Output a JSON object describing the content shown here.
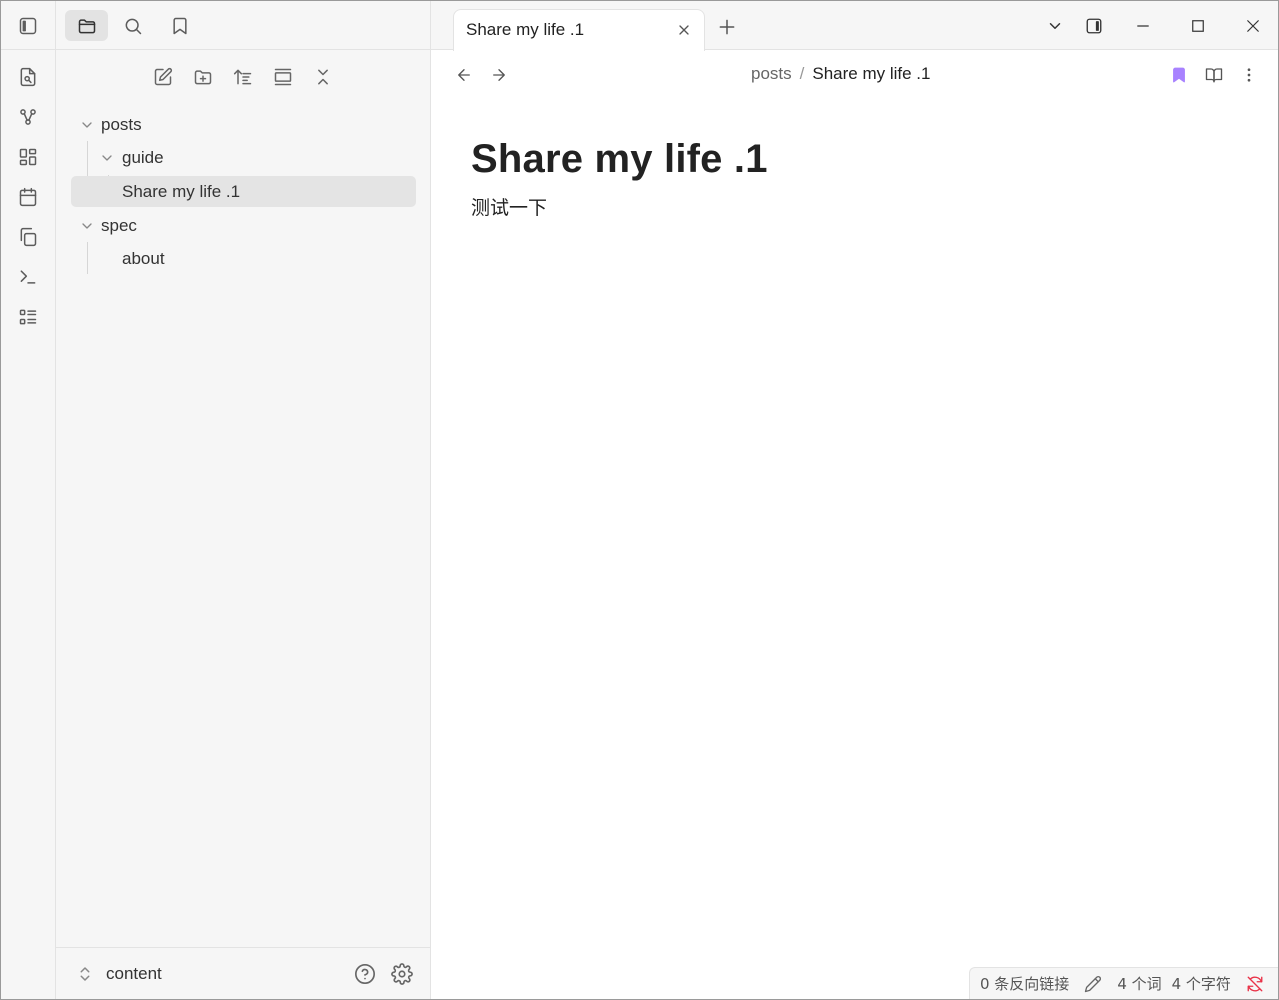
{
  "ribbon": {
    "toggle_icon": "sidebar-left-toggle-icon",
    "items": [
      {
        "icon": "file-search-icon"
      },
      {
        "icon": "graph-icon"
      },
      {
        "icon": "canvas-icon"
      },
      {
        "icon": "calendar-icon"
      },
      {
        "icon": "templates-icon"
      },
      {
        "icon": "command-palette-icon"
      },
      {
        "icon": "outline-list-icon"
      }
    ]
  },
  "sidebar": {
    "tabs": [
      {
        "icon": "folder-icon",
        "active": true
      },
      {
        "icon": "search-icon",
        "active": false
      },
      {
        "icon": "bookmark-icon",
        "active": false
      }
    ],
    "toolbar": [
      "new-note-icon",
      "new-folder-icon",
      "sort-icon",
      "auto-reveal-icon",
      "collapse-all-icon"
    ],
    "tree": [
      {
        "label": "posts",
        "type": "folder",
        "expanded": true,
        "depth": 0
      },
      {
        "label": "guide",
        "type": "folder",
        "expanded": true,
        "depth": 1
      },
      {
        "label": "Share my life .1",
        "type": "file",
        "depth": 2,
        "active": true
      },
      {
        "label": "spec",
        "type": "folder",
        "expanded": true,
        "depth": 0
      },
      {
        "label": "about",
        "type": "file",
        "depth": 1
      }
    ],
    "vault": {
      "name": "content"
    }
  },
  "tabs": [
    {
      "title": "Share my life .1",
      "active": true
    }
  ],
  "view": {
    "breadcrumb": {
      "parent": "posts",
      "separator": "/",
      "current": "Share my life .1"
    },
    "bookmark_color": "#a882ff"
  },
  "document": {
    "title": "Share my life .1",
    "body": "测试一下"
  },
  "statusbar": {
    "backlinks": "0 条反向链接",
    "words": "4 个词",
    "chars": "4 个字符",
    "sync_color": "#e93147"
  },
  "colors": {
    "accent": "#a882ff",
    "sidebar_bg": "#f6f6f6",
    "active_item_bg": "#e4e4e4"
  }
}
